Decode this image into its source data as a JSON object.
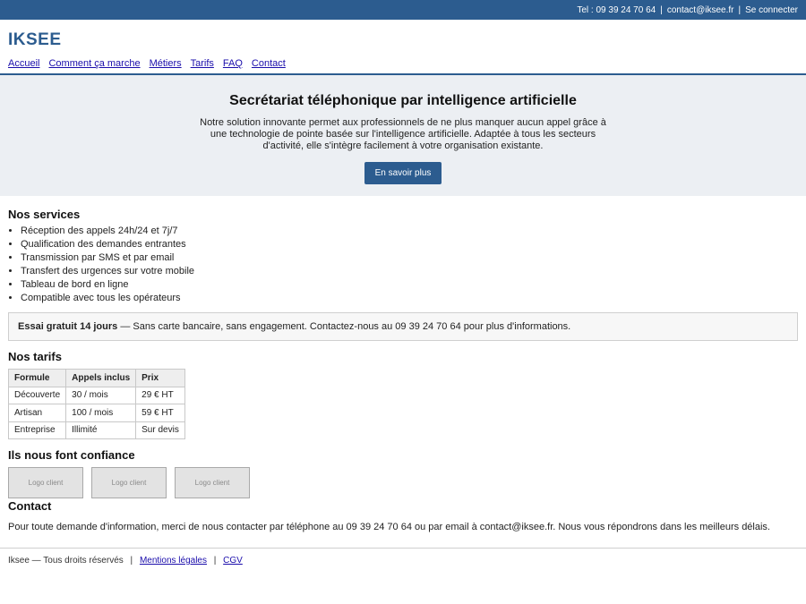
{
  "topbar": {
    "tel": "Tel : 09 39 24 70 64",
    "email": "contact@iksee.fr",
    "login": "Se connecter",
    "separator": "|"
  },
  "header": {
    "logo": "IKSEE",
    "nav": [
      "Accueil",
      "Comment ça marche",
      "Métiers",
      "Tarifs",
      "FAQ",
      "Contact"
    ]
  },
  "hero": {
    "title": "Secrétariat téléphonique par intelligence artificielle",
    "text": "Notre solution innovante permet aux professionnels de ne plus manquer aucun appel grâce à une technologie de pointe basée sur l'intelligence artificielle. Adaptée à tous les secteurs d'activité, elle s'intègre facilement à votre organisation existante.",
    "button": "En savoir plus"
  },
  "services": {
    "title": "Nos services",
    "items": [
      "Réception des appels 24h/24 et 7j/7",
      "Qualification des demandes entrantes",
      "Transmission par SMS et par email",
      "Transfert des urgences sur votre mobile",
      "Tableau de bord en ligne",
      "Compatible avec tous les opérateurs"
    ]
  },
  "trial": {
    "bold": "Essai gratuit 14 jours",
    "text": " — Sans carte bancaire, sans engagement. Contactez-nous au 09 39 24 70 64 pour plus d'informations."
  },
  "tarifs": {
    "title": "Nos tarifs",
    "headers": [
      "Formule",
      "Appels inclus",
      "Prix"
    ],
    "rows": [
      [
        "Découverte",
        "30 / mois",
        "29 € HT"
      ],
      [
        "Artisan",
        "100 / mois",
        "59 € HT"
      ],
      [
        "Entreprise",
        "Illimité",
        "Sur devis"
      ]
    ]
  },
  "trust": {
    "title": "Ils nous font confiance",
    "logos": [
      "Logo client",
      "Logo client",
      "Logo client"
    ]
  },
  "contact": {
    "title": "Contact",
    "text": "Pour toute demande d'information, merci de nous contacter par téléphone au 09 39 24 70 64 ou par email à contact@iksee.fr. Nous vous répondrons dans les meilleurs délais."
  },
  "footer": {
    "copyright": "Iksee — Tous droits réservés",
    "legal": "Mentions légales",
    "cgv": "CGV",
    "separator": "|"
  },
  "colors": {
    "primary": "#2c5c8f",
    "hero_bg": "#eceff3",
    "link": "#1a0dab"
  }
}
